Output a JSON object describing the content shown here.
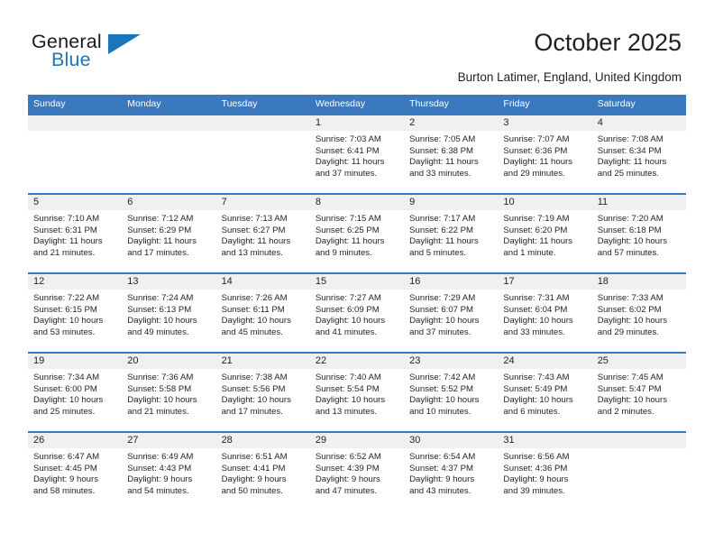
{
  "logo": {
    "word_one": "General",
    "word_two": "Blue",
    "accent_color": "#1b75bb"
  },
  "header": {
    "title": "October 2025",
    "subtitle": "Burton Latimer, England, United Kingdom"
  },
  "theme": {
    "header_bar_color": "#3a79bd",
    "date_band_color": "#f0f0f0",
    "text_color": "#231f20"
  },
  "weekdays": [
    "Sunday",
    "Monday",
    "Tuesday",
    "Wednesday",
    "Thursday",
    "Friday",
    "Saturday"
  ],
  "labels": {
    "sunrise_prefix": "Sunrise:",
    "sunset_prefix": "Sunset:",
    "daylight_prefix": "Daylight:"
  },
  "weeks": [
    [
      {
        "day": "",
        "sunrise": "",
        "sunset": "",
        "daylight": ""
      },
      {
        "day": "",
        "sunrise": "",
        "sunset": "",
        "daylight": ""
      },
      {
        "day": "",
        "sunrise": "",
        "sunset": "",
        "daylight": ""
      },
      {
        "day": "1",
        "sunrise": "Sunrise: 7:03 AM",
        "sunset": "Sunset: 6:41 PM",
        "daylight": "Daylight: 11 hours and 37 minutes."
      },
      {
        "day": "2",
        "sunrise": "Sunrise: 7:05 AM",
        "sunset": "Sunset: 6:38 PM",
        "daylight": "Daylight: 11 hours and 33 minutes."
      },
      {
        "day": "3",
        "sunrise": "Sunrise: 7:07 AM",
        "sunset": "Sunset: 6:36 PM",
        "daylight": "Daylight: 11 hours and 29 minutes."
      },
      {
        "day": "4",
        "sunrise": "Sunrise: 7:08 AM",
        "sunset": "Sunset: 6:34 PM",
        "daylight": "Daylight: 11 hours and 25 minutes."
      }
    ],
    [
      {
        "day": "5",
        "sunrise": "Sunrise: 7:10 AM",
        "sunset": "Sunset: 6:31 PM",
        "daylight": "Daylight: 11 hours and 21 minutes."
      },
      {
        "day": "6",
        "sunrise": "Sunrise: 7:12 AM",
        "sunset": "Sunset: 6:29 PM",
        "daylight": "Daylight: 11 hours and 17 minutes."
      },
      {
        "day": "7",
        "sunrise": "Sunrise: 7:13 AM",
        "sunset": "Sunset: 6:27 PM",
        "daylight": "Daylight: 11 hours and 13 minutes."
      },
      {
        "day": "8",
        "sunrise": "Sunrise: 7:15 AM",
        "sunset": "Sunset: 6:25 PM",
        "daylight": "Daylight: 11 hours and 9 minutes."
      },
      {
        "day": "9",
        "sunrise": "Sunrise: 7:17 AM",
        "sunset": "Sunset: 6:22 PM",
        "daylight": "Daylight: 11 hours and 5 minutes."
      },
      {
        "day": "10",
        "sunrise": "Sunrise: 7:19 AM",
        "sunset": "Sunset: 6:20 PM",
        "daylight": "Daylight: 11 hours and 1 minute."
      },
      {
        "day": "11",
        "sunrise": "Sunrise: 7:20 AM",
        "sunset": "Sunset: 6:18 PM",
        "daylight": "Daylight: 10 hours and 57 minutes."
      }
    ],
    [
      {
        "day": "12",
        "sunrise": "Sunrise: 7:22 AM",
        "sunset": "Sunset: 6:15 PM",
        "daylight": "Daylight: 10 hours and 53 minutes."
      },
      {
        "day": "13",
        "sunrise": "Sunrise: 7:24 AM",
        "sunset": "Sunset: 6:13 PM",
        "daylight": "Daylight: 10 hours and 49 minutes."
      },
      {
        "day": "14",
        "sunrise": "Sunrise: 7:26 AM",
        "sunset": "Sunset: 6:11 PM",
        "daylight": "Daylight: 10 hours and 45 minutes."
      },
      {
        "day": "15",
        "sunrise": "Sunrise: 7:27 AM",
        "sunset": "Sunset: 6:09 PM",
        "daylight": "Daylight: 10 hours and 41 minutes."
      },
      {
        "day": "16",
        "sunrise": "Sunrise: 7:29 AM",
        "sunset": "Sunset: 6:07 PM",
        "daylight": "Daylight: 10 hours and 37 minutes."
      },
      {
        "day": "17",
        "sunrise": "Sunrise: 7:31 AM",
        "sunset": "Sunset: 6:04 PM",
        "daylight": "Daylight: 10 hours and 33 minutes."
      },
      {
        "day": "18",
        "sunrise": "Sunrise: 7:33 AM",
        "sunset": "Sunset: 6:02 PM",
        "daylight": "Daylight: 10 hours and 29 minutes."
      }
    ],
    [
      {
        "day": "19",
        "sunrise": "Sunrise: 7:34 AM",
        "sunset": "Sunset: 6:00 PM",
        "daylight": "Daylight: 10 hours and 25 minutes."
      },
      {
        "day": "20",
        "sunrise": "Sunrise: 7:36 AM",
        "sunset": "Sunset: 5:58 PM",
        "daylight": "Daylight: 10 hours and 21 minutes."
      },
      {
        "day": "21",
        "sunrise": "Sunrise: 7:38 AM",
        "sunset": "Sunset: 5:56 PM",
        "daylight": "Daylight: 10 hours and 17 minutes."
      },
      {
        "day": "22",
        "sunrise": "Sunrise: 7:40 AM",
        "sunset": "Sunset: 5:54 PM",
        "daylight": "Daylight: 10 hours and 13 minutes."
      },
      {
        "day": "23",
        "sunrise": "Sunrise: 7:42 AM",
        "sunset": "Sunset: 5:52 PM",
        "daylight": "Daylight: 10 hours and 10 minutes."
      },
      {
        "day": "24",
        "sunrise": "Sunrise: 7:43 AM",
        "sunset": "Sunset: 5:49 PM",
        "daylight": "Daylight: 10 hours and 6 minutes."
      },
      {
        "day": "25",
        "sunrise": "Sunrise: 7:45 AM",
        "sunset": "Sunset: 5:47 PM",
        "daylight": "Daylight: 10 hours and 2 minutes."
      }
    ],
    [
      {
        "day": "26",
        "sunrise": "Sunrise: 6:47 AM",
        "sunset": "Sunset: 4:45 PM",
        "daylight": "Daylight: 9 hours and 58 minutes."
      },
      {
        "day": "27",
        "sunrise": "Sunrise: 6:49 AM",
        "sunset": "Sunset: 4:43 PM",
        "daylight": "Daylight: 9 hours and 54 minutes."
      },
      {
        "day": "28",
        "sunrise": "Sunrise: 6:51 AM",
        "sunset": "Sunset: 4:41 PM",
        "daylight": "Daylight: 9 hours and 50 minutes."
      },
      {
        "day": "29",
        "sunrise": "Sunrise: 6:52 AM",
        "sunset": "Sunset: 4:39 PM",
        "daylight": "Daylight: 9 hours and 47 minutes."
      },
      {
        "day": "30",
        "sunrise": "Sunrise: 6:54 AM",
        "sunset": "Sunset: 4:37 PM",
        "daylight": "Daylight: 9 hours and 43 minutes."
      },
      {
        "day": "31",
        "sunrise": "Sunrise: 6:56 AM",
        "sunset": "Sunset: 4:36 PM",
        "daylight": "Daylight: 9 hours and 39 minutes."
      },
      {
        "day": "",
        "sunrise": "",
        "sunset": "",
        "daylight": ""
      }
    ]
  ]
}
